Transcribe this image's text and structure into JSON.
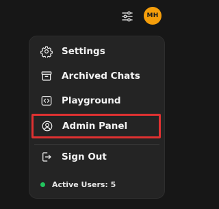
{
  "header": {
    "controls_icon": "sliders-icon",
    "avatar_initials": "MH",
    "avatar_color": "#f59e0b"
  },
  "menu": {
    "items": [
      {
        "label": "Settings",
        "icon": "gear-icon"
      },
      {
        "label": "Archived Chats",
        "icon": "archive-box-icon"
      },
      {
        "label": "Playground",
        "icon": "code-icon"
      },
      {
        "label": "Admin Panel",
        "icon": "user-circle-icon",
        "highlighted": true
      },
      {
        "label": "Sign Out",
        "icon": "sign-out-icon"
      }
    ],
    "active_users": {
      "label": "Active Users: 5",
      "status_color": "#22c55e"
    }
  },
  "colors": {
    "background": "#171717",
    "menu_background": "#242424",
    "highlight_border": "#e03131"
  }
}
